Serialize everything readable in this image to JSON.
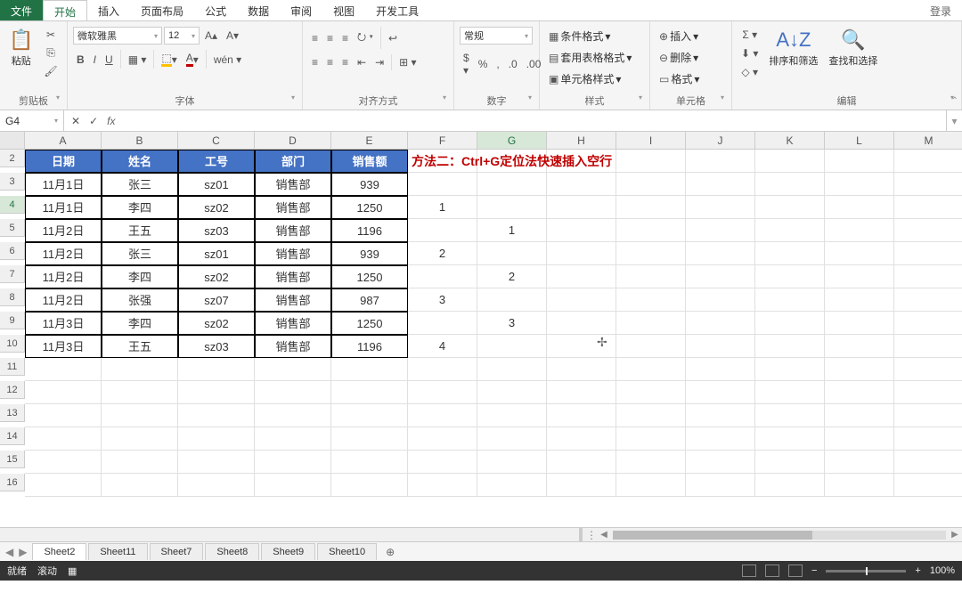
{
  "menu": {
    "file": "文件",
    "tabs": [
      "开始",
      "插入",
      "页面布局",
      "公式",
      "数据",
      "审阅",
      "视图",
      "开发工具"
    ],
    "active": 0,
    "login": "登录"
  },
  "ribbon": {
    "clipboard": {
      "paste": "粘贴",
      "label": "剪贴板"
    },
    "font": {
      "name": "微软雅黑",
      "size": "12",
      "bold": "B",
      "italic": "I",
      "underline": "U",
      "label": "字体"
    },
    "align": {
      "label": "对齐方式"
    },
    "number": {
      "format": "常规",
      "label": "数字"
    },
    "styles": {
      "cond": "条件格式",
      "table": "套用表格格式",
      "cell": "单元格样式",
      "label": "样式"
    },
    "cells": {
      "insert": "插入",
      "delete": "删除",
      "format": "格式",
      "label": "单元格"
    },
    "editing": {
      "sort": "排序和筛选",
      "find": "查找和选择",
      "label": "编辑"
    }
  },
  "fbar": {
    "name": "G4",
    "fx": "fx",
    "value": ""
  },
  "cols": [
    "A",
    "B",
    "C",
    "D",
    "E",
    "F",
    "G",
    "H",
    "I",
    "J",
    "K",
    "L",
    "M"
  ],
  "rows_shown": 15,
  "rows_start": 2,
  "headers": [
    "日期",
    "姓名",
    "工号",
    "部门",
    "销售额"
  ],
  "data": [
    [
      "11月1日",
      "张三",
      "sz01",
      "销售部",
      "939",
      "",
      "",
      ""
    ],
    [
      "11月1日",
      "李四",
      "sz02",
      "销售部",
      "1250",
      "1",
      "",
      ""
    ],
    [
      "11月2日",
      "王五",
      "sz03",
      "销售部",
      "1196",
      "",
      "1",
      ""
    ],
    [
      "11月2日",
      "张三",
      "sz01",
      "销售部",
      "939",
      "2",
      "",
      ""
    ],
    [
      "11月2日",
      "李四",
      "sz02",
      "销售部",
      "1250",
      "",
      "2",
      ""
    ],
    [
      "11月2日",
      "张强",
      "sz07",
      "销售部",
      "987",
      "3",
      "",
      ""
    ],
    [
      "11月3日",
      "李四",
      "sz02",
      "销售部",
      "1250",
      "",
      "3",
      ""
    ],
    [
      "11月3日",
      "王五",
      "sz03",
      "销售部",
      "1196",
      "4",
      "",
      ""
    ]
  ],
  "annotation": "方法二：Ctrl+G定位法快速插入空行",
  "sheets": [
    "Sheet2",
    "Sheet11",
    "Sheet7",
    "Sheet8",
    "Sheet9",
    "Sheet10"
  ],
  "sheet_active": 0,
  "status": {
    "ready": "就绪",
    "scroll": "滚动",
    "zoom": "100%"
  }
}
